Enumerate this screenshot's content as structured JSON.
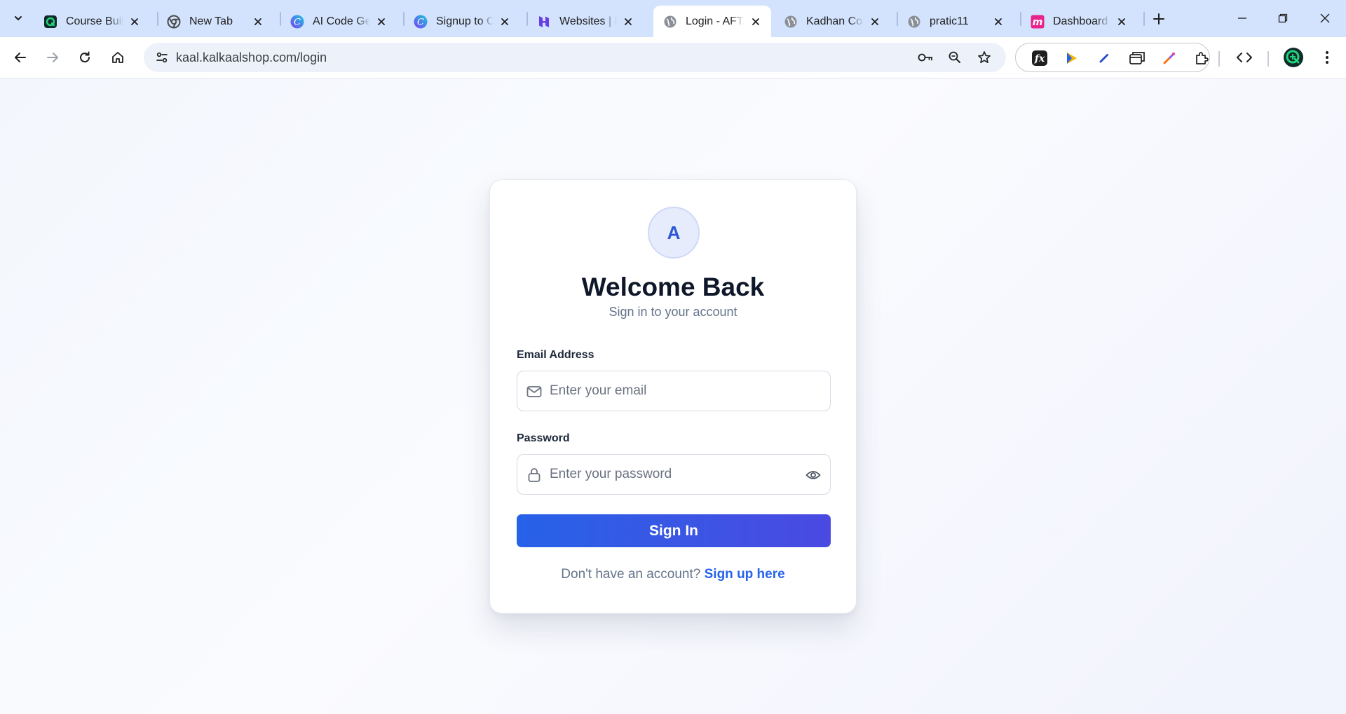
{
  "browser": {
    "tabs": [
      {
        "title": "Course Builder",
        "favicon": "course-builder-icon",
        "active": false
      },
      {
        "title": "New Tab",
        "favicon": "chrome-icon",
        "active": false
      },
      {
        "title": "AI Code Generator",
        "favicon": "canva-icon",
        "active": false
      },
      {
        "title": "Signup to Canva",
        "favicon": "canva-icon",
        "active": false
      },
      {
        "title": "Websites | Hostinger",
        "favicon": "hostinger-icon",
        "active": false
      },
      {
        "title": "Login - AFTAB",
        "favicon": "globe-icon",
        "active": true
      },
      {
        "title": "Kadhan Cosmetics",
        "favicon": "globe-icon",
        "active": false
      },
      {
        "title": "pratic11",
        "favicon": "globe-icon",
        "active": false
      },
      {
        "title": "Dashboard",
        "favicon": "m-brand-icon",
        "active": false
      }
    ],
    "address": "kaal.kalkaalshop.com/login",
    "extensions": [
      "fx-extension-icon",
      "arrow-cursor-extension-icon",
      "pen-extension-icon",
      "window-extension-icon",
      "color-picker-extension-icon",
      "puzzle-icon"
    ],
    "colors": {
      "tabstrip": "#d3e3fd",
      "omnibox": "#edf2fa"
    }
  },
  "login": {
    "avatar_letter": "A",
    "title": "Welcome Back",
    "subtitle": "Sign in to your account",
    "email": {
      "label": "Email Address",
      "placeholder": "Enter your email",
      "value": ""
    },
    "password": {
      "label": "Password",
      "placeholder": "Enter your password",
      "value": ""
    },
    "submit_label": "Sign In",
    "footer_text": "Don't have an account?",
    "signup_link": "Sign up here",
    "colors": {
      "accent": "#2563eb",
      "button_end": "#4a49e2",
      "heading": "#0f172a",
      "muted": "#64748b"
    }
  }
}
